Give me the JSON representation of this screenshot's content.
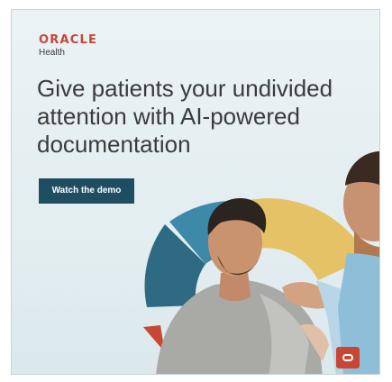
{
  "brand": {
    "name": "ORACLE",
    "sub": "Health",
    "color": "#c74634"
  },
  "headline": "Give patients your undivided attention with AI-powered documentation",
  "cta": {
    "label": "Watch the demo",
    "color": "#1f4e63"
  },
  "icons": {
    "corner": "oracle-o-icon"
  }
}
